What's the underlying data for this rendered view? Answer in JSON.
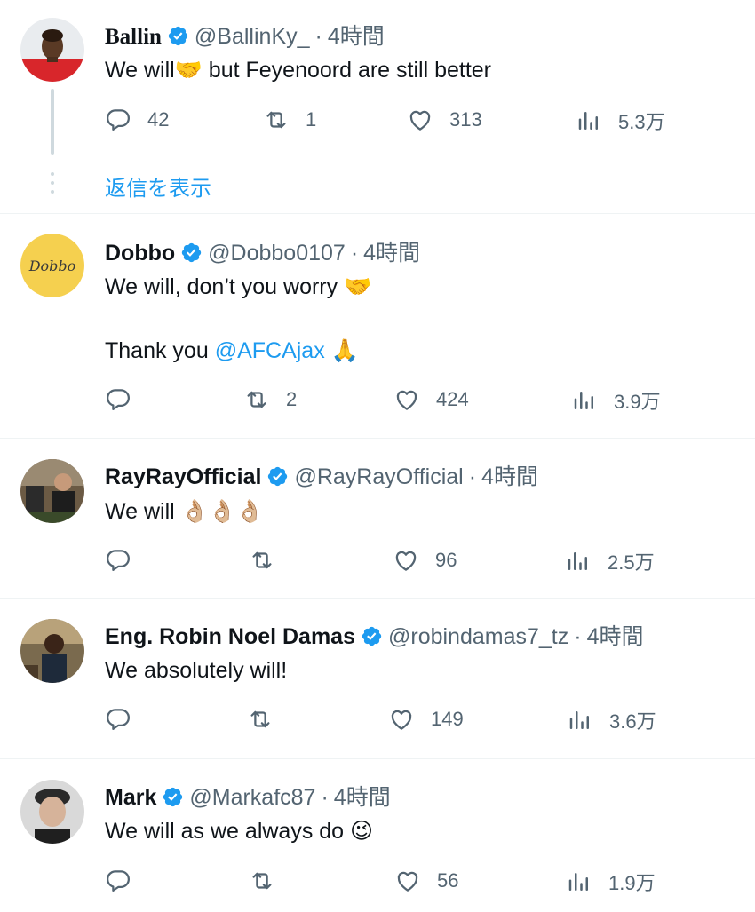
{
  "tweets": [
    {
      "name": "Ballin",
      "handle": "@BallinKy_",
      "sep": "·",
      "time": "4時間",
      "text1": "We will🤝 but Feyenoord are still better",
      "text2": "",
      "counts": {
        "reply": "42",
        "retweet": "1",
        "like": "313",
        "views": "5.3万"
      },
      "show_replies": "返信を表示"
    },
    {
      "name": "Dobbo",
      "handle": "@Dobbo0107",
      "sep": "·",
      "time": "4時間",
      "avatar_text": "Dobbo",
      "text1": "We will, don’t you worry 🤝",
      "text2_prefix": "Thank you ",
      "text2_mention": "@AFCAjax",
      "text2_suffix": " 🙏",
      "counts": {
        "reply": "",
        "retweet": "2",
        "like": "424",
        "views": "3.9万"
      }
    },
    {
      "name": "RayRayOfficial",
      "handle": "@RayRayOfficial",
      "sep": "·",
      "time": "4時間",
      "text1": "We will 👌🏼👌🏼👌🏼",
      "counts": {
        "reply": "",
        "retweet": "",
        "like": "96",
        "views": "2.5万"
      }
    },
    {
      "name": "Eng. Robin Noel Damas",
      "handle": "@robindamas7_tz",
      "sep": "·",
      "time": "4時間",
      "text1": "We absolutely will!",
      "counts": {
        "reply": "",
        "retweet": "",
        "like": "149",
        "views": "3.6万"
      }
    },
    {
      "name": "Mark",
      "handle": "@Markafc87",
      "sep": "·",
      "time": "4時間",
      "text1": "We will as we always do 😉",
      "counts": {
        "reply": "",
        "retweet": "",
        "like": "56",
        "views": "1.9万"
      }
    }
  ],
  "colors": {
    "accent": "#1d9bf0",
    "muted": "#536471",
    "text": "#0f1419",
    "border": "#eff3f4"
  }
}
